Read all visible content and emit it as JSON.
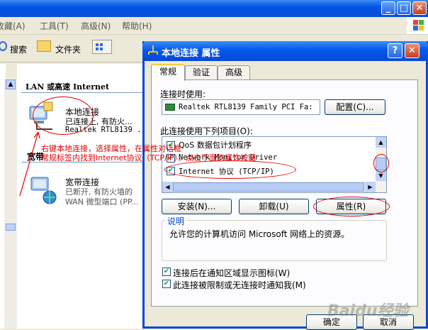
{
  "explorer": {
    "menu": [
      "收藏(A)",
      "工具(T)",
      "高级(N)",
      "帮助(H)"
    ],
    "toolbar": {
      "search_label": "搜索",
      "folders_label": "文件夹"
    },
    "group_lan": "LAN 或高速 Internet",
    "group_broadband": "宽带",
    "connections": [
      {
        "name": "本地连接",
        "status": "已连接上, 有防火...",
        "device": "Realtek RTL8139 ..."
      },
      {
        "name": "宽带连接",
        "status": "已断开, 有防火墙的",
        "device": "WAN 微型端口 (PP..."
      }
    ]
  },
  "dialog": {
    "title": "本地连接 属性",
    "help_btn": "?",
    "close_btn": "✕",
    "tabs": [
      "常规",
      "验证",
      "高级"
    ],
    "connect_using_label": "连接时使用:",
    "adapter": "Realtek RTL8139 Family PCI Fa:",
    "configure_btn": "配置(C)...",
    "items_label": "此连接使用下列项目(O):",
    "items": [
      {
        "label": "QoS 数据包计划程序",
        "checked": true
      },
      {
        "label": "Network Monitor Driver",
        "checked": true
      },
      {
        "label": "Internet 协议 (TCP/IP)",
        "checked": true
      }
    ],
    "install_btn": "安装(N)...",
    "uninstall_btn": "卸载(U)",
    "properties_btn": "属性(R)",
    "description_title": "说明",
    "description_text": "允许您的计算机访问 Microsoft 网络上的资源。",
    "check_show_icon": "连接后在通知区域显示图标(W)",
    "check_notify": "此连接被限制或无连接时通知我(M)",
    "ok_btn": "确定",
    "cancel_btn": "取消"
  },
  "annotation": {
    "line1": "右键本地连接，选择属性，在属性对话框",
    "line2": "常规标签内找到Internet协议（TCP/IP），点击下面的属性按钮"
  },
  "watermark": "Baidu经验",
  "colors": {
    "annotation_red": "#E00000",
    "xp_blue": "#0054E3"
  }
}
